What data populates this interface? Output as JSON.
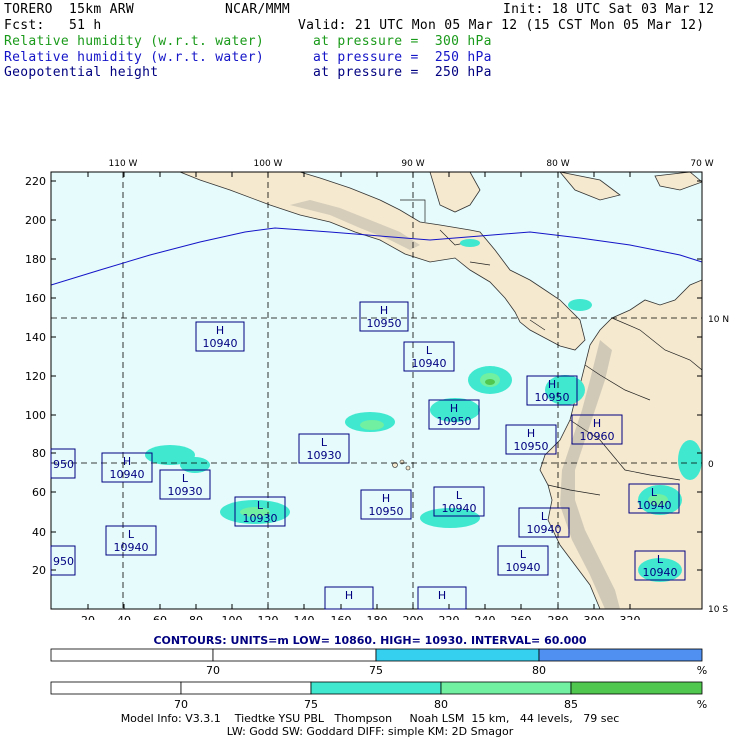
{
  "header": {
    "model": "TORERO  15km ARW",
    "center": "NCAR/MMM",
    "init": "Init: 18 UTC Sat 03 Mar 12",
    "fcst": "Fcst:   51 h",
    "valid": "Valid: 21 UTC Mon 05 Mar 12 (15 CST Mon 05 Mar 12)",
    "fields": [
      {
        "name": "Relative humidity (w.r.t. water)",
        "level": "at pressure =  300 hPa",
        "color": "#1a9a1a"
      },
      {
        "name": "Relative humidity (w.r.t. water)",
        "level": "at pressure =  250 hPa",
        "color": "#1414c8"
      },
      {
        "name": "Geopotential height",
        "level": "at pressure =  250 hPa",
        "color": "#000080"
      }
    ]
  },
  "map": {
    "lon_labels": [
      "110 W",
      "100 W",
      "90 W",
      "80 W",
      "70 W"
    ],
    "lat_labels": [
      "10 N",
      "0",
      "10 S"
    ],
    "y_ticks": [
      "220",
      "200",
      "180",
      "160",
      "140",
      "120",
      "100",
      "80",
      "60",
      "40",
      "20"
    ],
    "x_ticks": [
      "20",
      "40",
      "60",
      "80",
      "100",
      "120",
      "140",
      "160",
      "180",
      "200",
      "220",
      "240",
      "260",
      "280",
      "300",
      "320"
    ],
    "centers": [
      {
        "type": "H",
        "value": "10950"
      },
      {
        "type": "H",
        "value": "10940"
      },
      {
        "type": "L",
        "value": "10940"
      },
      {
        "type": "H",
        "value": "10950"
      },
      {
        "type": "H",
        "value": "10950"
      },
      {
        "type": "H",
        "value": "10960"
      },
      {
        "type": "L",
        "value": "10930"
      },
      {
        "type": "H",
        "value": "10950"
      },
      {
        "type": "H",
        "value": "10940"
      },
      {
        "type": "L",
        "value": "10930"
      },
      {
        "type": "L",
        "value": "10930"
      },
      {
        "type": "H",
        "value": "10950"
      },
      {
        "type": "L",
        "value": "10940"
      },
      {
        "type": "L",
        "value": "10940"
      },
      {
        "type": "L",
        "value": "10940"
      },
      {
        "type": "L",
        "value": "10940"
      },
      {
        "type": "L",
        "value": "10940"
      },
      {
        "type": "L",
        "value": "10940"
      },
      {
        "type": "",
        "value": "950"
      },
      {
        "type": "",
        "value": "950"
      },
      {
        "type": "H",
        "value": ""
      },
      {
        "type": "H",
        "value": ""
      }
    ]
  },
  "contours_info": "CONTOURS:  UNITS=m  LOW=  10860.        HIGH=  10930.      INTERVAL=   60.000",
  "colorbar1": {
    "labels": [
      "70",
      "75",
      "80"
    ],
    "unit": "%",
    "colors": [
      "#ffffff",
      "#ffffff",
      "#35d0f0",
      "#5090f0"
    ]
  },
  "colorbar2": {
    "labels": [
      "70",
      "75",
      "80",
      "85"
    ],
    "unit": "%",
    "colors": [
      "#ffffff",
      "#ffffff",
      "#40e8d0",
      "#70f0a0",
      "#50c850"
    ]
  },
  "footer": {
    "line1": "Model Info: V3.3.1    Tiedtke YSU PBL   Thompson     Noah LSM  15 km,   44 levels,   79 sec",
    "line2": "LW: Godd SW: Goddard DIFF: simple KM: 2D Smagor"
  }
}
